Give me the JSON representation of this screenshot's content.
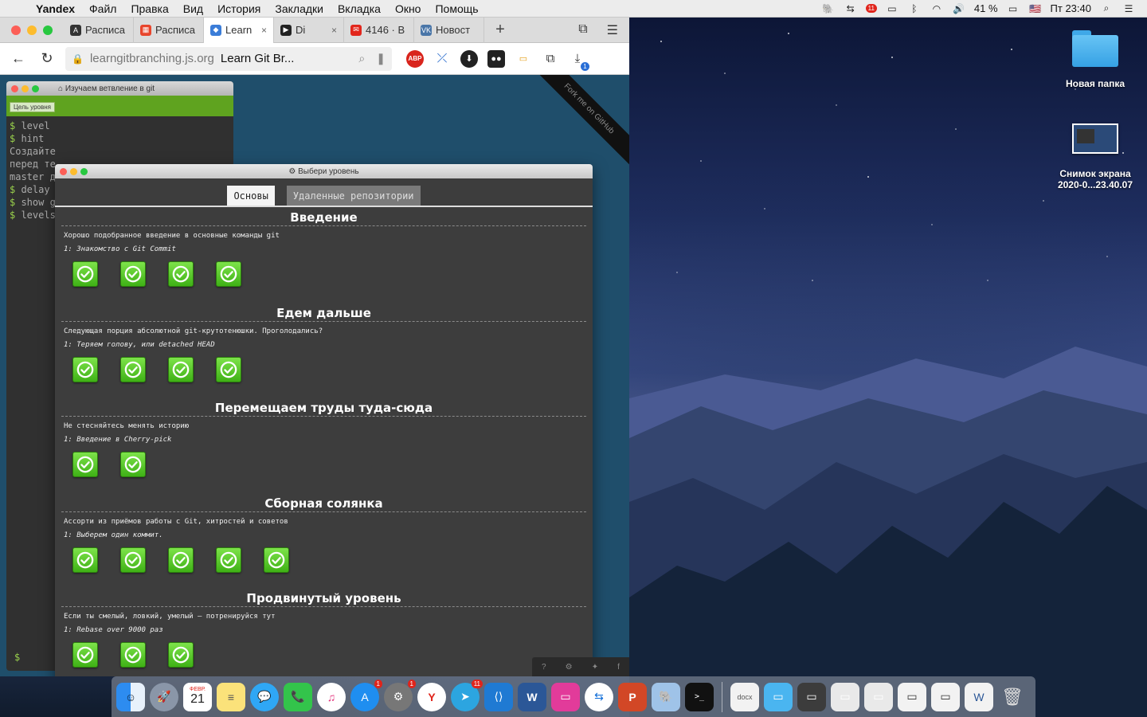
{
  "menubar": {
    "app": "Yandex",
    "items": [
      "Файл",
      "Правка",
      "Вид",
      "История",
      "Закладки",
      "Вкладка",
      "Окно",
      "Помощь"
    ],
    "notif_badge": "11",
    "battery": "41 %",
    "clock": "Пт 23:40"
  },
  "browser": {
    "tabs": [
      {
        "label": "Расписа",
        "fav_color": "#333333",
        "fav_glyph": "A"
      },
      {
        "label": "Расписа",
        "fav_color": "#e8452c",
        "fav_glyph": "▦"
      },
      {
        "label": "Learn",
        "fav_color": "#3b7dd8",
        "fav_glyph": "◆",
        "active": true
      },
      {
        "label": "Di",
        "fav_color": "#222222",
        "fav_glyph": "▶"
      },
      {
        "label": "4146 · B",
        "fav_color": "#e2261c",
        "fav_glyph": "✉"
      },
      {
        "label": "Новост",
        "fav_color": "#4a76a8",
        "fav_glyph": "VK"
      }
    ],
    "address_host": "learngitbranching.js.org",
    "address_title": "Learn Git Br...",
    "download_badge": "1"
  },
  "terminal": {
    "title": "Изучаем ветвление в git",
    "toolbar_btn": "Цель уровня",
    "lines": [
      {
        "type": "cmd",
        "text": "level"
      },
      {
        "type": "cmd",
        "text": "hint"
      },
      {
        "type": "txt",
        "text": "Создайте"
      },
      {
        "type": "txt",
        "text": "перед те"
      },
      {
        "type": "txt",
        "text": "master д"
      },
      {
        "type": "cmd",
        "text": "delay"
      },
      {
        "type": "cmd",
        "text": "show g"
      },
      {
        "type": "cmd",
        "text": "levels"
      }
    ],
    "prompt": "$"
  },
  "fork_ribbon": "Fork me on GitHub",
  "dialog": {
    "title": "Выбери уровень",
    "tabs": {
      "main": "Основы",
      "remote": "Удаленные репозитории"
    },
    "sections": [
      {
        "title": "Введение",
        "desc": "Хорошо подобранное введение в основные команды git",
        "level": "1: Знакомство с Git Commit",
        "count": 4
      },
      {
        "title": "Едем дальше",
        "desc": "Следующая порция абсолютной git-крутотенюшки. Проголодались?",
        "level": "1: Теряем голову, или detached HEAD",
        "count": 4
      },
      {
        "title": "Перемещаем труды туда-сюда",
        "desc": "Не стесняйтесь менять историю",
        "level": "1: Введение в Cherry-pick",
        "count": 2
      },
      {
        "title": "Сборная солянка",
        "desc": "Ассорти из приёмов работы с Git, хитростей и советов",
        "level": "1: Выберем один коммит.",
        "count": 5
      },
      {
        "title": "Продвинутый уровень",
        "desc": "Если ты смелый, ловкий, умелый – потренируйся тут",
        "level": "1: Rebase over 9000 раз",
        "count": 3
      }
    ]
  },
  "desktop": {
    "folder_label": "Новая папка",
    "screenshot_label_1": "Снимок экрана",
    "screenshot_label_2": "2020-0...23.40.07"
  },
  "dock": {
    "date_month": "ФЕВР.",
    "date_day": "21",
    "badges": {
      "appstore": "1",
      "settings": "1",
      "telegram": "11"
    }
  },
  "colors": {
    "level_green": "#4fc21f",
    "dialog_bg": "#3d3d3d",
    "page_bg": "#1f4e6b"
  }
}
